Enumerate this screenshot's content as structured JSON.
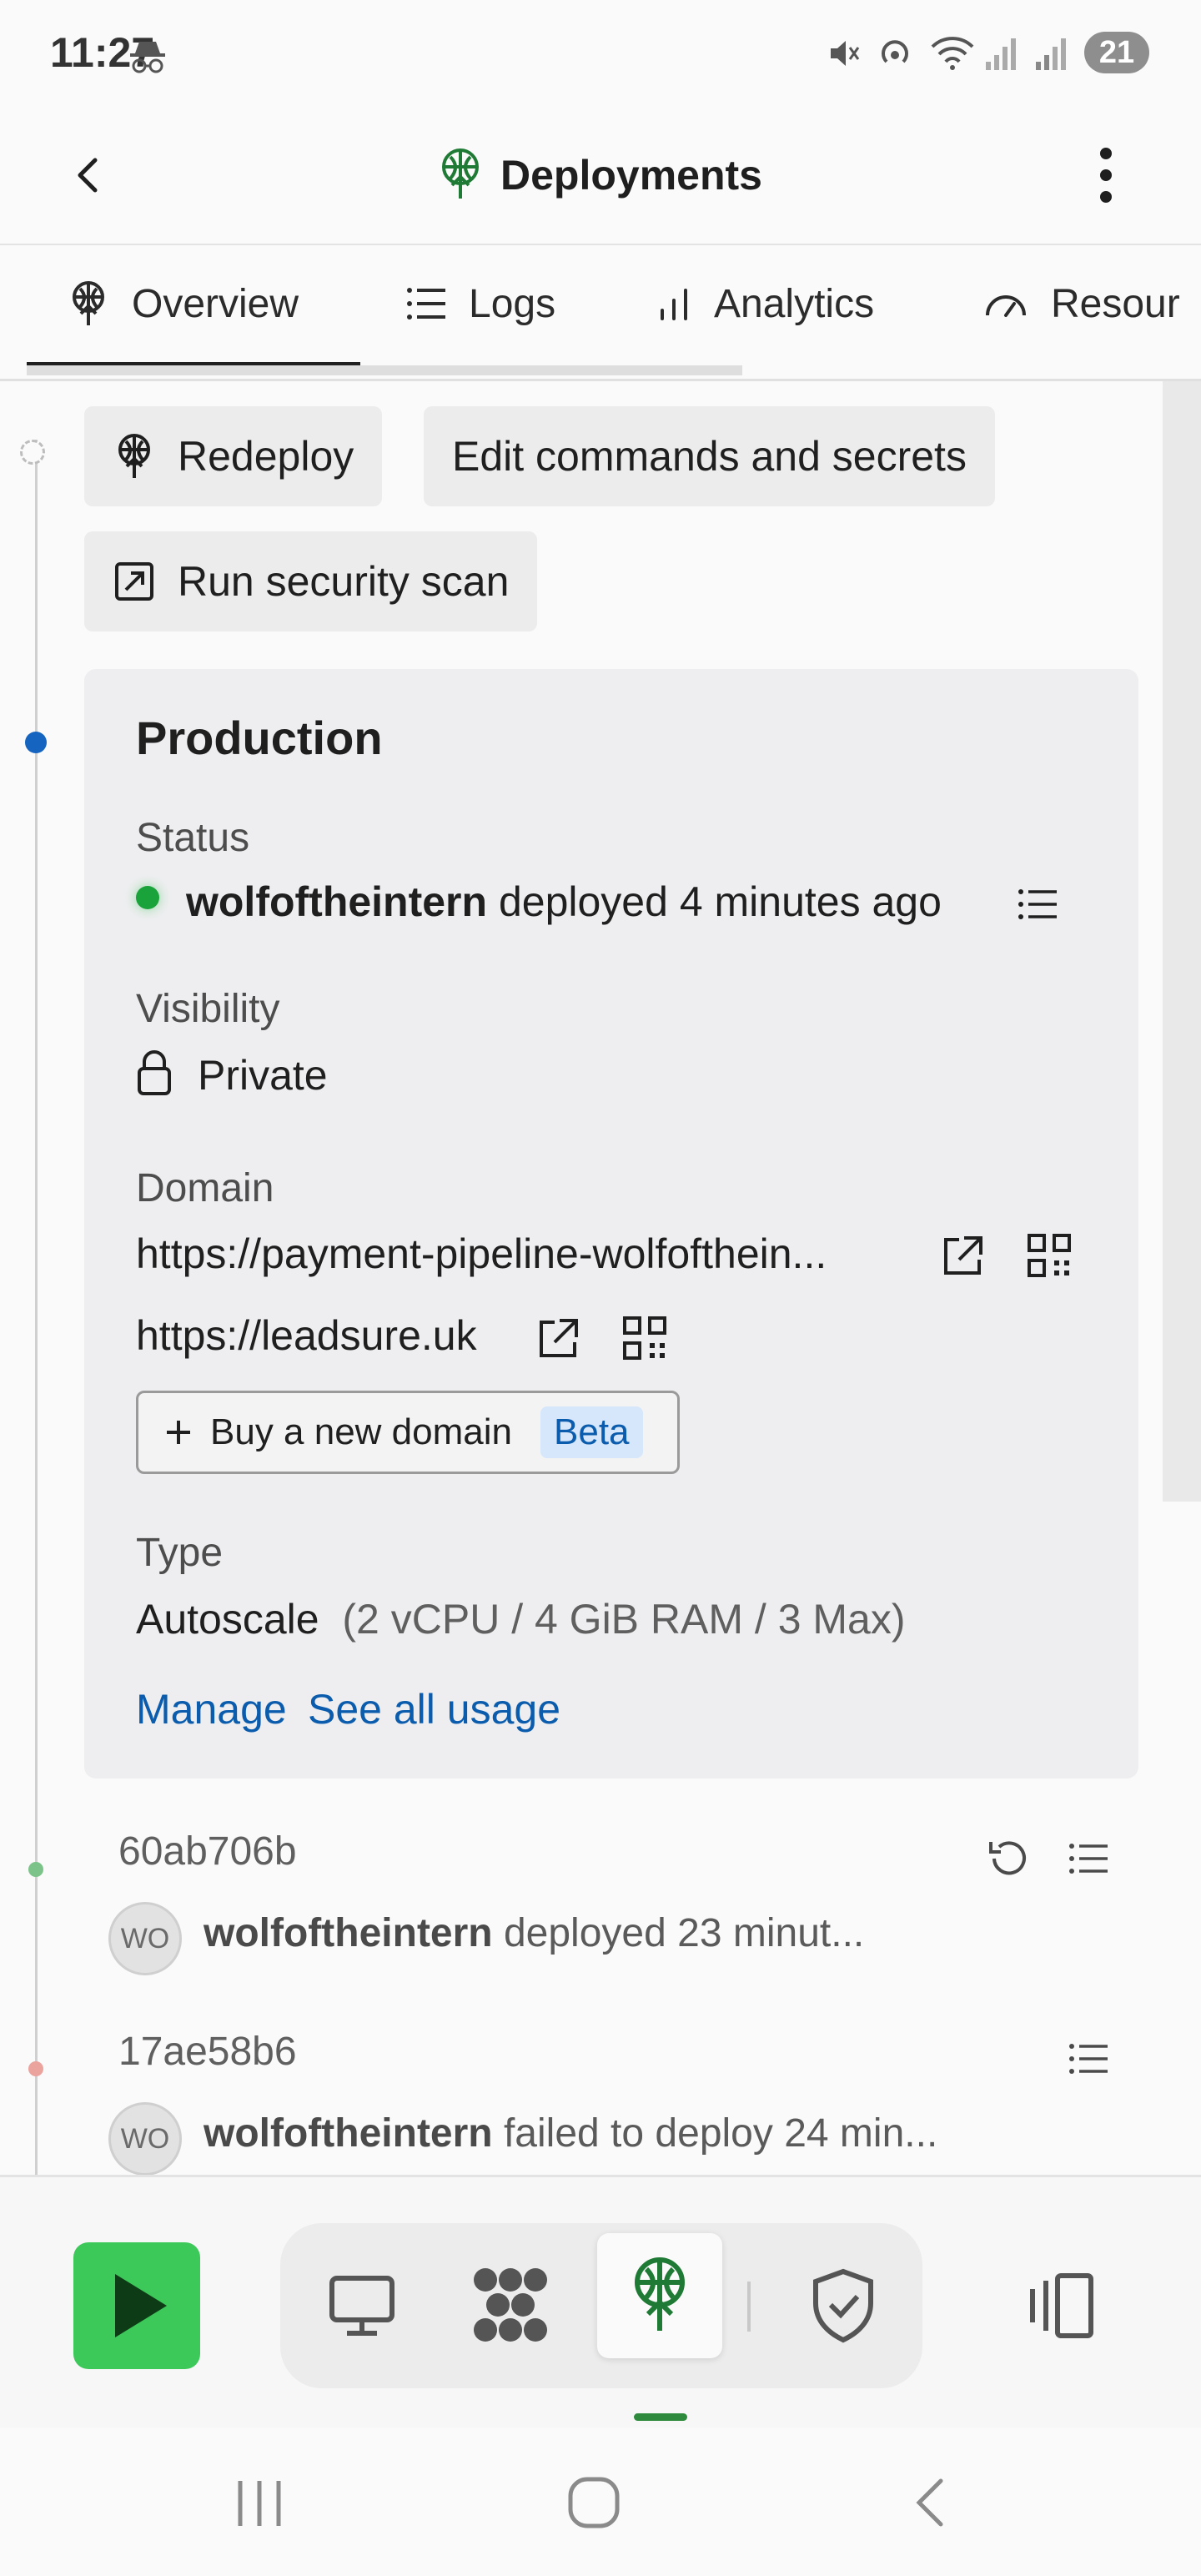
{
  "status_bar": {
    "time": "11:27",
    "battery": "21"
  },
  "header": {
    "title": "Deployments"
  },
  "tabs": [
    {
      "label": "Overview",
      "icon": "deployments-icon",
      "active": true
    },
    {
      "label": "Logs",
      "icon": "list-icon"
    },
    {
      "label": "Analytics",
      "icon": "bar-chart-icon"
    },
    {
      "label": "Resour",
      "icon": "gauge-icon"
    }
  ],
  "actions": {
    "redeploy": "Redeploy",
    "edit_commands": "Edit commands and secrets",
    "security_scan": "Run security scan"
  },
  "production": {
    "title": "Production",
    "status_label": "Status",
    "status_user": "wolfoftheintern",
    "status_text": "deployed 4 minutes ago",
    "visibility_label": "Visibility",
    "visibility_value": "Private",
    "domain_label": "Domain",
    "domains": [
      "https://payment-pipeline-wolfofthein...",
      "https://leadsure.uk"
    ],
    "buy_domain": "Buy a new domain",
    "beta_badge": "Beta",
    "type_label": "Type",
    "type_value": "Autoscale",
    "type_detail": "(2 vCPU / 4 GiB RAM / 3 Max)",
    "manage_link": "Manage",
    "usage_link": "See all usage",
    "colors": {
      "status_dot": "#1aa33a",
      "link": "#0b5cad",
      "timeline_active": "#1565c0"
    }
  },
  "history": [
    {
      "hash": "60ab706b",
      "avatar": "WO",
      "user": "wolfoftheintern",
      "text": "deployed 23 minut...",
      "status_color": "#7cc38a"
    },
    {
      "hash": "17ae58b6",
      "avatar": "WO",
      "user": "wolfoftheintern",
      "text": "failed to deploy 24 min...",
      "status_color": "#eba39e"
    }
  ],
  "bottom_tools": [
    "preview-icon",
    "workspace-icon",
    "deployments-icon",
    "security-icon"
  ],
  "accent": {
    "run": "#3cc95a",
    "deploy_green": "#1e7a34"
  }
}
